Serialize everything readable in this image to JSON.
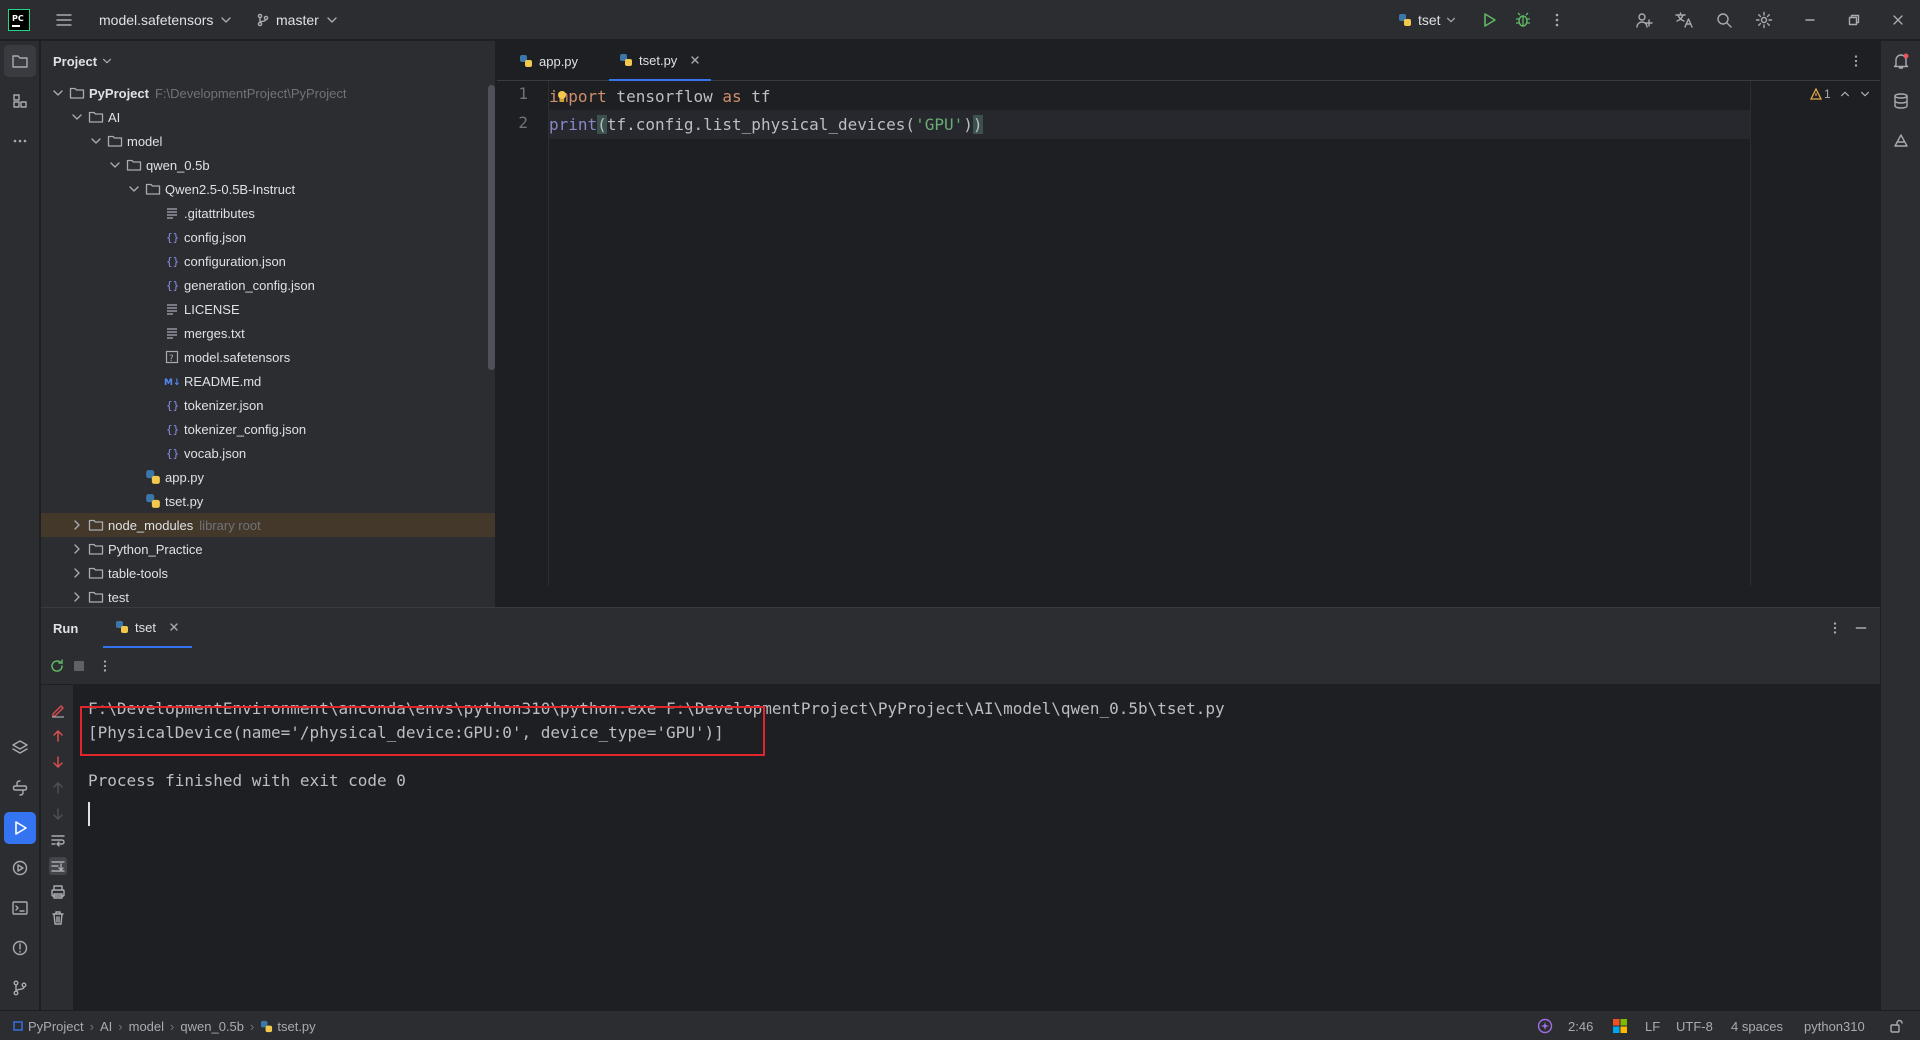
{
  "titlebar": {
    "project_name": "model.safetensors",
    "branch": "master",
    "run_config": "tset"
  },
  "project_panel": {
    "title": "Project",
    "tree": [
      {
        "label": "PyProject",
        "hint": "F:\\DevelopmentProject\\PyProject",
        "type": "folder",
        "expanded": true,
        "depth": 0,
        "bold": true
      },
      {
        "label": "AI",
        "hint": "",
        "type": "folder",
        "expanded": true,
        "depth": 1
      },
      {
        "label": "model",
        "hint": "",
        "type": "folder",
        "expanded": true,
        "depth": 2
      },
      {
        "label": "qwen_0.5b",
        "hint": "",
        "type": "folder",
        "expanded": true,
        "depth": 3
      },
      {
        "label": "Qwen2.5-0.5B-Instruct",
        "hint": "",
        "type": "folder",
        "expanded": true,
        "depth": 4
      },
      {
        "label": ".gitattributes",
        "hint": "",
        "type": "text",
        "depth": 5
      },
      {
        "label": "config.json",
        "hint": "",
        "type": "json",
        "depth": 5
      },
      {
        "label": "configuration.json",
        "hint": "",
        "type": "json",
        "depth": 5
      },
      {
        "label": "generation_config.json",
        "hint": "",
        "type": "json",
        "depth": 5
      },
      {
        "label": "LICENSE",
        "hint": "",
        "type": "text",
        "depth": 5
      },
      {
        "label": "merges.txt",
        "hint": "",
        "type": "text",
        "depth": 5
      },
      {
        "label": "model.safetensors",
        "hint": "",
        "type": "unknown",
        "depth": 5
      },
      {
        "label": "README.md",
        "hint": "",
        "type": "markdown",
        "depth": 5
      },
      {
        "label": "tokenizer.json",
        "hint": "",
        "type": "json",
        "depth": 5
      },
      {
        "label": "tokenizer_config.json",
        "hint": "",
        "type": "json",
        "depth": 5
      },
      {
        "label": "vocab.json",
        "hint": "",
        "type": "json",
        "depth": 5
      },
      {
        "label": "app.py",
        "hint": "",
        "type": "python",
        "depth": 4
      },
      {
        "label": "tset.py",
        "hint": "",
        "type": "python",
        "depth": 4
      },
      {
        "label": "node_modules",
        "hint": "library root",
        "type": "folder",
        "expanded": false,
        "depth": 1,
        "selected": true
      },
      {
        "label": "Python_Practice",
        "hint": "",
        "type": "folder",
        "expanded": false,
        "depth": 1
      },
      {
        "label": "table-tools",
        "hint": "",
        "type": "folder",
        "expanded": false,
        "depth": 1
      },
      {
        "label": "test",
        "hint": "",
        "type": "folder",
        "expanded": false,
        "depth": 1
      }
    ]
  },
  "editor": {
    "tabs": [
      {
        "label": "app.py",
        "active": false
      },
      {
        "label": "tset.py",
        "active": true
      }
    ],
    "line_numbers": [
      "1",
      "2"
    ],
    "line1": {
      "kw1": "import",
      "mod": " tensorflow ",
      "kw2": "as",
      "alias": " tf"
    },
    "line2": {
      "fn": "print",
      "p1": "(",
      "body": "tf.config.list_physical_devices(",
      "str": "'GPU'",
      "p2": ")",
      "p3": ")"
    },
    "warnings": "1"
  },
  "run_panel": {
    "title": "Run",
    "tab_label": "tset",
    "console": [
      "F:\\DevelopmentEnvironment\\anconda\\envs\\python310\\python.exe F:\\DevelopmentProject\\PyProject\\AI\\model\\qwen_0.5b\\tset.py",
      "[PhysicalDevice(name='/physical_device:GPU:0', device_type='GPU')]",
      "",
      "Process finished with exit code 0"
    ]
  },
  "statusbar": {
    "breadcrumb": [
      "PyProject",
      "AI",
      "model",
      "qwen_0.5b",
      "tset.py"
    ],
    "position": "2:46",
    "line_sep": "LF",
    "encoding": "UTF-8",
    "indent": "4 spaces",
    "interpreter": "python310"
  },
  "colors": {
    "accent": "#3574f0",
    "highlight_box": "#e0262c",
    "selected_row": "#43382a"
  }
}
